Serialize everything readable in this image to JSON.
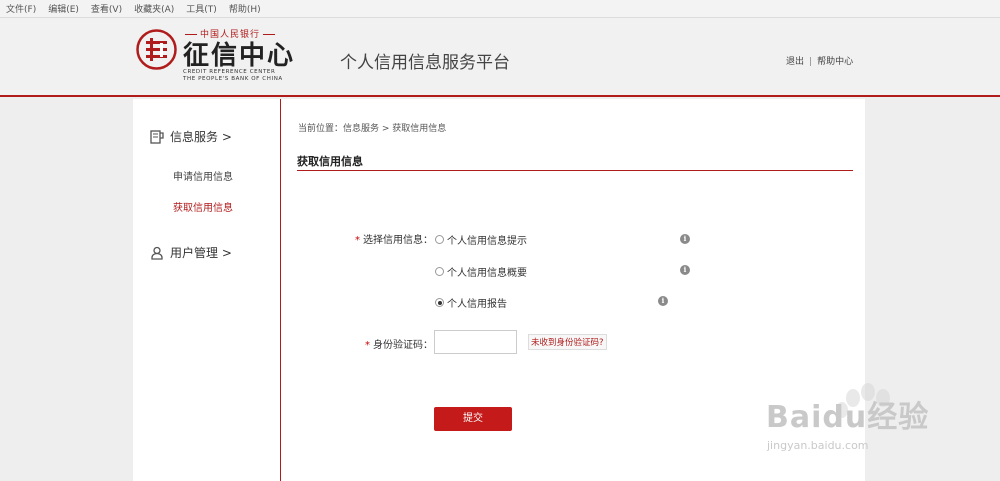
{
  "menu": [
    "文件(F)",
    "编辑(E)",
    "查看(V)",
    "收藏夹(A)",
    "工具(T)",
    "帮助(H)"
  ],
  "header": {
    "logo_top": "中国人民银行",
    "logo_name": "征信中心",
    "logo_en_line1": "CREDIT REFERENCE CENTER",
    "logo_en_line2": "THE PEOPLE'S BANK OF CHINA",
    "platform_title": "个人信用信息服务平台",
    "logout": "退出",
    "separator": "|",
    "help": "帮助中心"
  },
  "sidebar": {
    "info_service": "信息服务 >",
    "apply_credit": "申请信用信息",
    "get_credit": "获取信用信息",
    "user_mgmt": "用户管理 >"
  },
  "main": {
    "breadcrumb": "当前位置：信息服务 > 获取信用信息",
    "section_title": "获取信用信息",
    "select_label": "选择信用信息：",
    "options": [
      "个人信用信息提示",
      "个人信用信息概要",
      "个人信用报告"
    ],
    "selected_option": "个人信用报告",
    "code_label": "身份验证码：",
    "required_mark": "*",
    "not_received": "未收到身份验证码?",
    "submit": "提交"
  },
  "watermark": {
    "brand": "Baidu经验",
    "url": "jingyan.baidu.com"
  },
  "colors": {
    "accent": "#b01c1c",
    "button": "#c41a1a"
  }
}
